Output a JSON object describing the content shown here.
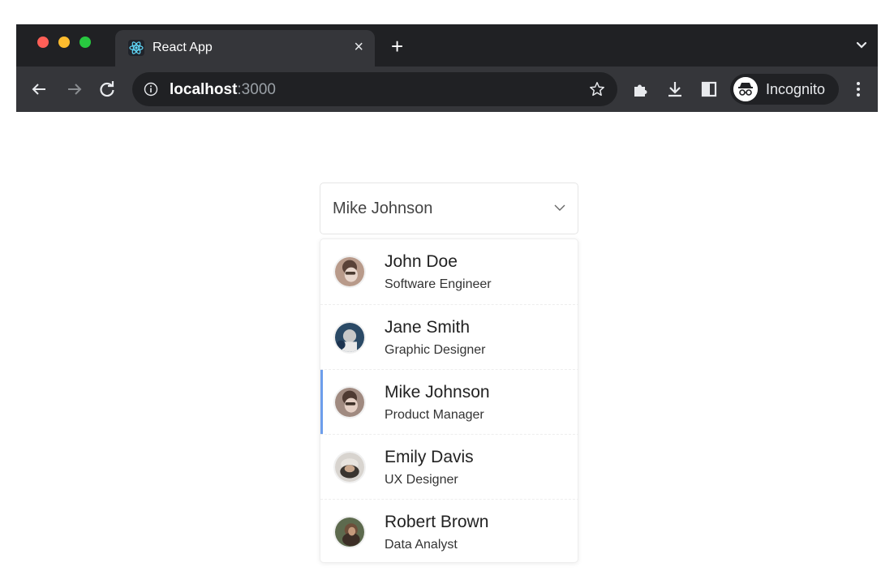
{
  "browser": {
    "tab_title": "React App",
    "tab_close": "×",
    "new_tab": "+",
    "url_host": "localhost",
    "url_port": ":3000",
    "incognito_label": "Incognito"
  },
  "select": {
    "selected_value": "Mike Johnson"
  },
  "users": [
    {
      "name": "John Doe",
      "role": "Software Engineer"
    },
    {
      "name": "Jane Smith",
      "role": "Graphic Designer"
    },
    {
      "name": "Mike Johnson",
      "role": "Product Manager"
    },
    {
      "name": "Emily Davis",
      "role": "UX Designer"
    },
    {
      "name": "Robert Brown",
      "role": "Data Analyst"
    }
  ],
  "colors": {
    "selected_indicator": "#6d9eeb"
  },
  "icons": [
    "react-favicon-icon",
    "close-icon",
    "plus-icon",
    "chevron-down-icon",
    "back-icon",
    "forward-icon",
    "reload-icon",
    "info-icon",
    "star-icon",
    "extensions-icon",
    "download-icon",
    "side-panel-icon",
    "incognito-icon",
    "more-vert-icon"
  ]
}
